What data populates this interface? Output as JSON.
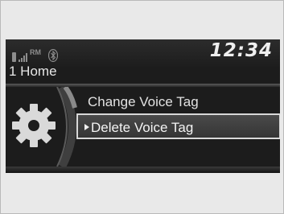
{
  "status": {
    "icons": [
      "phone-icon",
      "signal-strength-icon",
      "roaming-icon",
      "bluetooth-icon"
    ],
    "roaming": "RM",
    "clock": "12:34"
  },
  "screen": {
    "context_label": "1 Home"
  },
  "menu": {
    "icon": "gear-icon",
    "items": [
      {
        "label": "Change Voice Tag",
        "selected": false
      },
      {
        "label": "Delete Voice Tag",
        "selected": true
      }
    ]
  },
  "colors": {
    "screen_bg": "#1c1c1c",
    "frame_bg": "#e9e9e9",
    "text": "#e2e2e2",
    "selection_border": "#d8d8d8"
  }
}
